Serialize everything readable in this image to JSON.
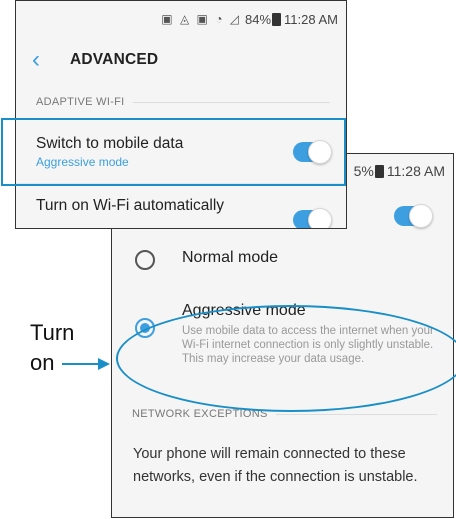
{
  "screen1": {
    "status_icons": "▣ ◬ ▣ ◔ ◿",
    "status_battery": "84%",
    "status_time": "11:28 AM",
    "title": "ADVANCED",
    "section": "ADAPTIVE WI-FI",
    "item1_title": "Switch to mobile data",
    "item1_sub": "Aggressive mode",
    "item2_title": "Turn on Wi-Fi automatically"
  },
  "screen2": {
    "status_battery": "5%",
    "status_time": "11:28 AM",
    "on_label": "ON",
    "normal_label": "Normal mode",
    "aggressive_label": "Aggressive mode",
    "aggressive_desc": "Use mobile data to access the internet when your Wi-Fi internet connection is only slightly unstable. This may increase your data usage.",
    "section": "NETWORK EXCEPTIONS",
    "exceptions_text": "Your phone will remain connected to these networks, even if the connection is unstable."
  },
  "annotation": {
    "line1": "Turn",
    "line2": "on"
  },
  "colors": {
    "accent": "#3d9fe0",
    "highlight": "#1a8fc7"
  }
}
